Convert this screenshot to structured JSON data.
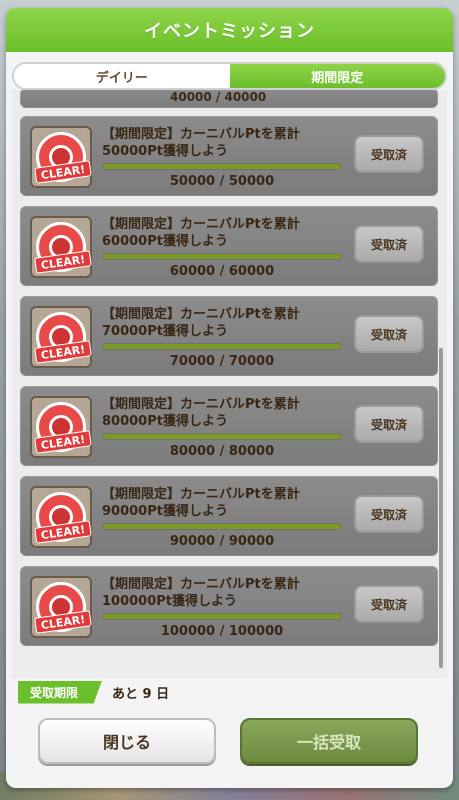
{
  "header": {
    "title": "イベントミッション"
  },
  "tabs": [
    {
      "label": "デイリー",
      "active": false
    },
    {
      "label": "期間限定",
      "active": true
    }
  ],
  "partial_row": {
    "progress": "40000 / 40000"
  },
  "missions": [
    {
      "title": "【期間限定】カーニバルPtを累計\n50000Pt獲得しよう",
      "progress": "50000 / 50000",
      "fraction": 1.0,
      "badge": "CLEAR!",
      "button": "受取済"
    },
    {
      "title": "【期間限定】カーニバルPtを累計\n60000Pt獲得しよう",
      "progress": "60000 / 60000",
      "fraction": 1.0,
      "badge": "CLEAR!",
      "button": "受取済"
    },
    {
      "title": "【期間限定】カーニバルPtを累計\n70000Pt獲得しよう",
      "progress": "70000 / 70000",
      "fraction": 1.0,
      "badge": "CLEAR!",
      "button": "受取済"
    },
    {
      "title": "【期間限定】カーニバルPtを累計\n80000Pt獲得しよう",
      "progress": "80000 / 80000",
      "fraction": 1.0,
      "badge": "CLEAR!",
      "button": "受取済"
    },
    {
      "title": "【期間限定】カーニバルPtを累計\n90000Pt獲得しよう",
      "progress": "90000 / 90000",
      "fraction": 1.0,
      "badge": "CLEAR!",
      "button": "受取済"
    },
    {
      "title": "【期間限定】カーニバルPtを累計\n100000Pt獲得しよう",
      "progress": "100000 / 100000",
      "fraction": 1.0,
      "badge": "CLEAR!",
      "button": "受取済"
    }
  ],
  "deadline": {
    "label": "受取期限",
    "value": "あと 9 日"
  },
  "buttons": {
    "close": "閉じる",
    "claim_all": "一括受取"
  },
  "colors": {
    "accent": "#6bbf2a",
    "card": "#8c8c8c",
    "clear_badge": "#e03a3a"
  }
}
